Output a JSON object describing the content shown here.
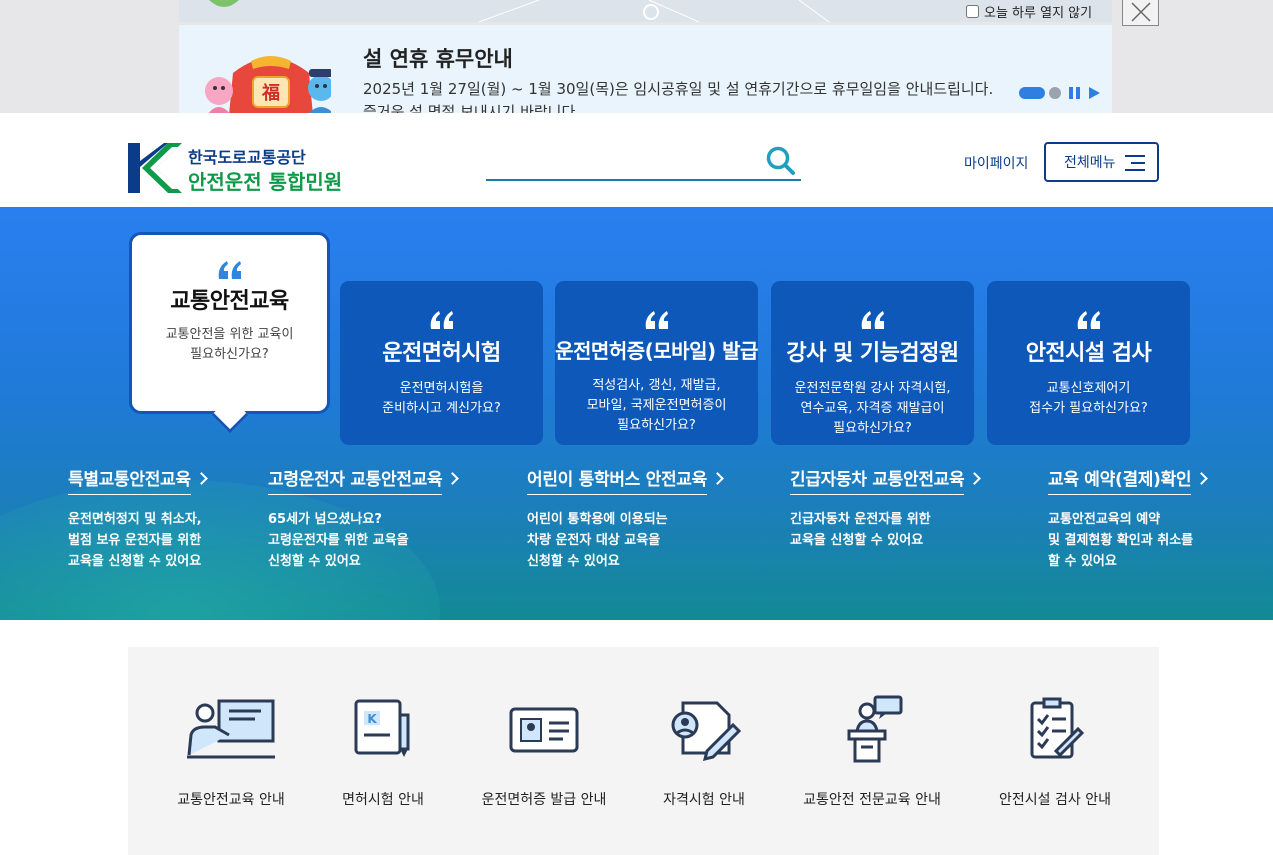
{
  "popup": {
    "title": "설 연휴 휴무안내",
    "line1": "2025년 1월 27일(월) ~ 1월 30일(목)은 임시공휴일 및 설 연휴기간으로 휴무일임을 안내드립니다.",
    "line2": "즐거운 설 명절 보내시기 바랍니다",
    "art_char": "福",
    "no_today": "오늘 하루 열지 않기"
  },
  "header": {
    "org_name": "한국도로교통공단",
    "service_name": "안전운전 통합민원",
    "search_placeholder": "",
    "mypage": "마이페이지",
    "all_menu": "전체메뉴"
  },
  "cards": [
    {
      "title": "교통안전교육",
      "desc1": "교통안전을 위한 교육이",
      "desc2": "필요하신가요?",
      "desc3": ""
    },
    {
      "title": "운전면허시험",
      "desc1": "운전면허시험을",
      "desc2": "준비하시고 계신가요?",
      "desc3": ""
    },
    {
      "title": "운전면허증(모바일) 발급",
      "desc1": "적성검사, 갱신, 재발급,",
      "desc2": "모바일, 국제운전면허증이",
      "desc3": "필요하신가요?"
    },
    {
      "title": "강사 및 기능검정원",
      "desc1": "운전전문학원 강사 자격시험,",
      "desc2": "연수교육, 자격증 재발급이",
      "desc3": "필요하신가요?"
    },
    {
      "title": "안전시설 검사",
      "desc1": "교통신호제어기",
      "desc2": "접수가 필요하신가요?",
      "desc3": ""
    }
  ],
  "services": [
    {
      "title": "특별교통안전교육",
      "d1": "운전면허정지 및 취소자,",
      "d2": "벌점 보유 운전자를 위한",
      "d3": "교육을 신청할 수 있어요"
    },
    {
      "title": "고령운전자 교통안전교육",
      "d1": "65세가 넘으셨나요?",
      "d2": "고령운전자를 위한 교육을",
      "d3": "신청할 수 있어요"
    },
    {
      "title": "어린이 통학버스 안전교육",
      "d1": "어린이 통학용에 이용되는",
      "d2": "차량 운전자 대상 교육을",
      "d3": "신청할 수 있어요"
    },
    {
      "title": "긴급자동차 교통안전교육",
      "d1": "긴급자동차 운전자를 위한",
      "d2": "교육을 신청할 수 있어요",
      "d3": ""
    },
    {
      "title": "교육 예약(결제)확인",
      "d1": "교통안전교육의 예약",
      "d2": "및 결제현황 확인과 취소를",
      "d3": "할 수 있어요"
    }
  ],
  "quick_links": [
    {
      "label": "교통안전교육 안내",
      "icon": "lecture-icon"
    },
    {
      "label": "면허시험 안내",
      "icon": "license-test-icon"
    },
    {
      "label": "운전면허증 발급 안내",
      "icon": "id-card-icon"
    },
    {
      "label": "자격시험 안내",
      "icon": "certificate-exam-icon"
    },
    {
      "label": "교통안전 전문교육 안내",
      "icon": "speaker-podium-icon"
    },
    {
      "label": "안전시설 검사 안내",
      "icon": "checklist-icon"
    }
  ],
  "colors": {
    "navy": "#0b3c8a",
    "green": "#0f9a4a",
    "card_blue": "#0d58b8",
    "hero_top": "#2a7ff0",
    "hero_bottom": "#128a95",
    "accent": "#2f7fe0"
  }
}
